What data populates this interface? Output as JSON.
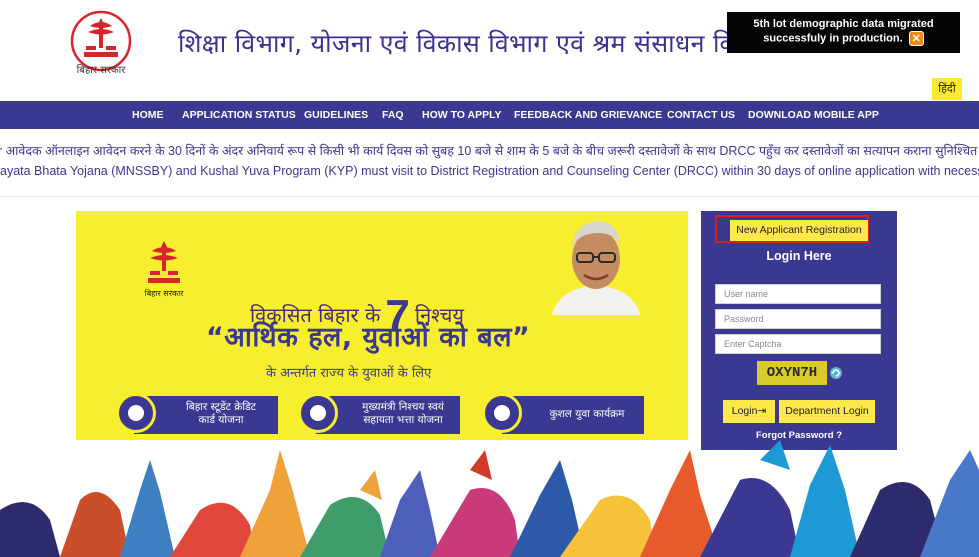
{
  "header": {
    "emblem_caption": "बिहार सरकार",
    "title": "शिक्षा विभाग, योजना एवं विकास विभाग एवं श्रम संसाधन विभाग",
    "notice_line1": "5th lot demographic data migrated",
    "notice_line2": "successfuly in production.",
    "notice_close_icon": "close-icon",
    "language_button": "हिंदी"
  },
  "nav": {
    "items": [
      "HOME",
      "APPLICATION STATUS",
      "GUIDELINES",
      "FAQ",
      "HOW TO APPLY",
      "FEEDBACK AND GRIEVANCE",
      "CONTACT US",
      "DOWNLOAD MOBILE APP"
    ]
  },
  "marquee": {
    "hindi": "r आवेदक ऑनलाइन आवेदन करने के 30 दिनों के अंदर अनिवार्य रूप से किसी भी कार्य दिवस को सुबह 10 बजे से शाम के 5 बजे के बीच जरूरी दस्तावेजों के साथ DRCC पहुँच कर दस्तावेजों का सत्यापन कराना सुनिश्चित करें",
    "english": "ayata Bhata Yojana (MNSSBY) and Kushal Yuva Program (KYP) must visit to District Registration and Counseling Center (DRCC) within 30 days of online application with necessary documen"
  },
  "banner": {
    "emblem_caption": "बिहार सरकार",
    "line1_pre": "विकसित बिहार के",
    "line1_num": "7",
    "line1_post": "निश्चय",
    "line2": "“आर्थिक हल, युवाओं को बल”",
    "line3": "के अन्तर्गत राज्य के युवाओं के लिए",
    "schemes": [
      {
        "line1": "बिहार स्टूडेंट क्रेडिट",
        "line2": "कार्ड योजना"
      },
      {
        "line1": "मुख्यमंत्री निश्चय स्वयं",
        "line2": "सहायता भत्ता योजना"
      },
      {
        "line1": "कुशल युवा कार्यक्रम",
        "line2": ""
      }
    ]
  },
  "login": {
    "new_registration": "New Applicant Registration",
    "title": "Login Here",
    "username_placeholder": "User name",
    "password_placeholder": "Password",
    "captcha_placeholder": "Enter Captcha",
    "captcha_text": "OXYN7H",
    "refresh_icon": "refresh-icon",
    "login_button": "Login",
    "login_icon": "sign-in-icon",
    "department_login": "Department Login",
    "forgot_password": "Forgot Password ?"
  },
  "colors": {
    "nav_bg": "#3b3892",
    "banner_bg": "#f7ef2e",
    "button_yellow": "#ffe84a",
    "highlight_red": "#e21b1b"
  }
}
